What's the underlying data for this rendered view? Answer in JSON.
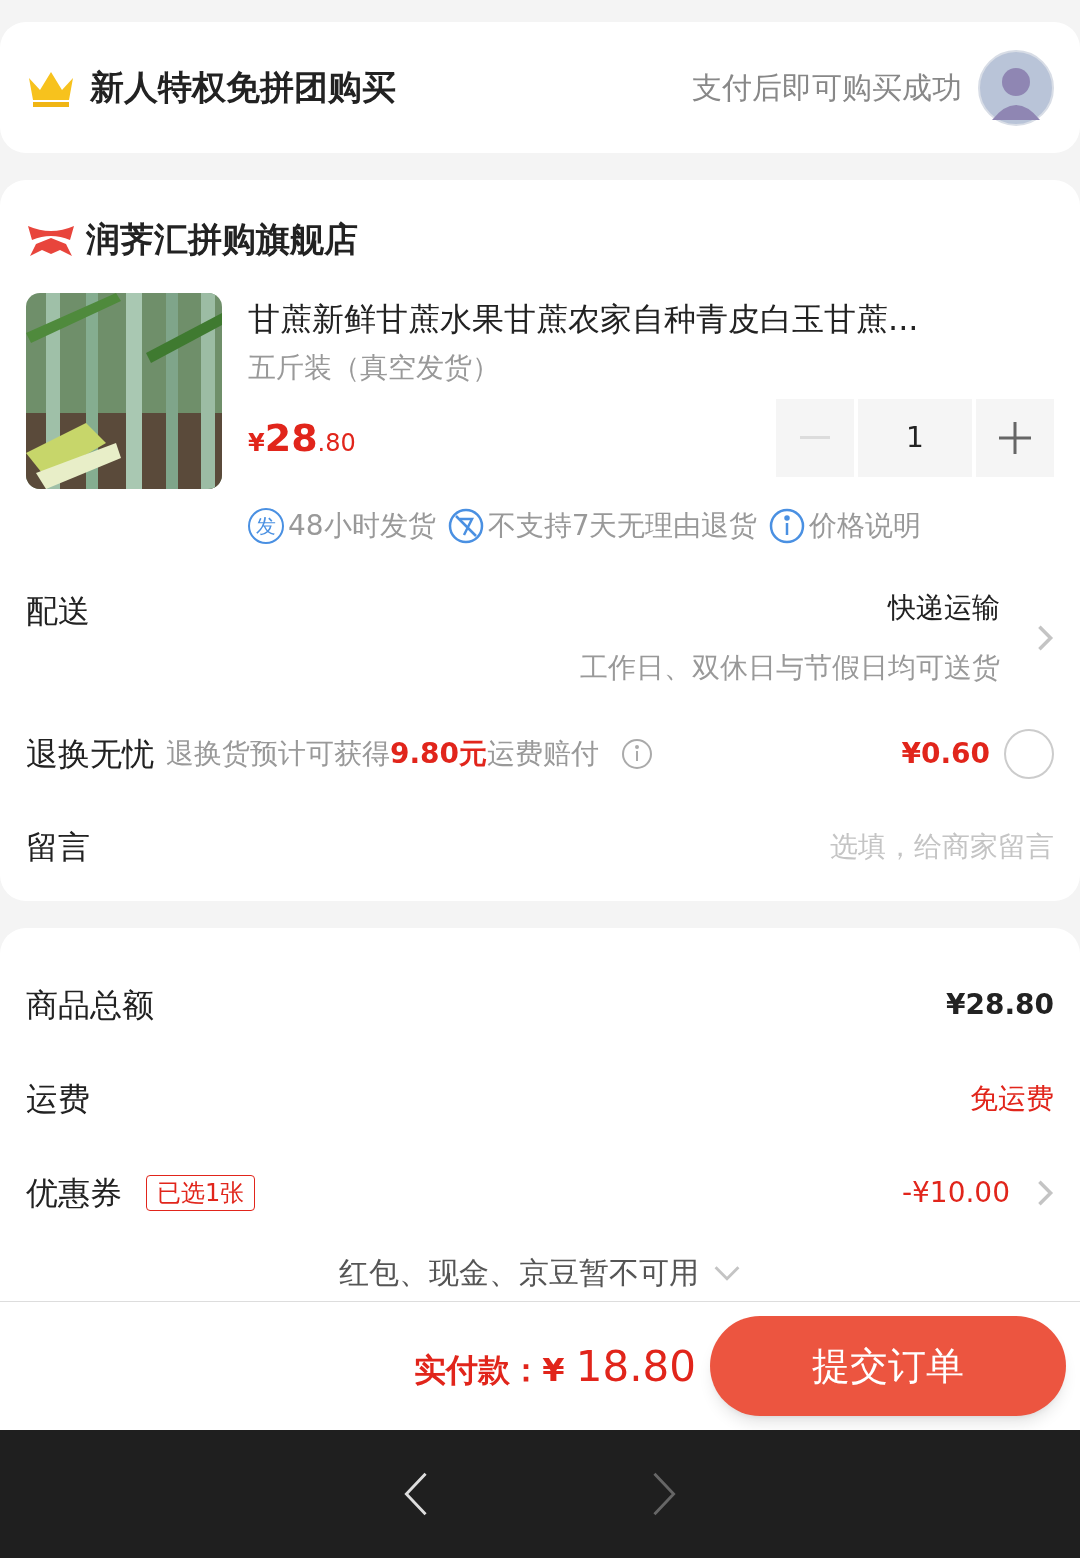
{
  "banner": {
    "title": "新人特权免拼团购买",
    "note": "支付后即可购买成功"
  },
  "store": {
    "name": "润荠汇拼购旗舰店"
  },
  "product": {
    "title": "甘蔗新鲜甘蔗水果甘蔗农家自种青皮白玉甘蔗...",
    "spec": "五斤装（真空发货）",
    "currency": "¥",
    "price_int": "28",
    "price_dec": ".80",
    "quantity": "1",
    "minus_disabled": true,
    "tags": [
      {
        "kind": "badge",
        "icon_text": "发",
        "label": "48小时发货"
      },
      {
        "kind": "no-return",
        "label": "不支持7天无理由退货"
      },
      {
        "kind": "info",
        "label": "价格说明"
      }
    ]
  },
  "delivery": {
    "label": "配送",
    "method": "快递运输",
    "note": "工作日、双休日与节假日均可送货"
  },
  "return_insurance": {
    "label": "退换无忧",
    "desc_before": "退换货预计可获得",
    "desc_highlight": "9.80元",
    "desc_after": "运费赔付",
    "price": "¥0.60",
    "checked": false
  },
  "message": {
    "label": "留言",
    "placeholder": "选填，给商家留言"
  },
  "summary": [
    {
      "label": "商品总额",
      "value": "¥28.80",
      "highlight": false,
      "chevron": false
    },
    {
      "label": "运费",
      "value": "免运费",
      "highlight": true,
      "chevron": false
    },
    {
      "label": "优惠券",
      "badge": "已选1张",
      "value": "-¥10.00",
      "highlight": true,
      "chevron": true
    }
  ],
  "unavailable": {
    "text": "红包、现金、京豆暂不可用"
  },
  "footer": {
    "pay_label": "实付款：",
    "currency": "¥",
    "amount_int": "18",
    "amount_dec": ".80",
    "submit": "提交订单"
  },
  "nav": {
    "back_disabled": false,
    "forward_disabled": true
  }
}
